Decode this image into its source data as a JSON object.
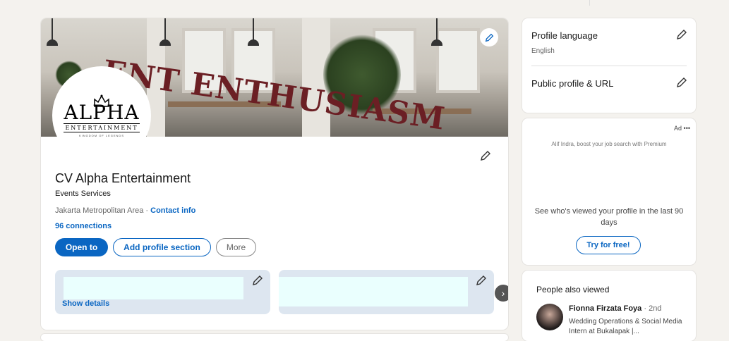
{
  "profile": {
    "banner_text": "ENT ENTHUSIASM",
    "logo": {
      "name": "ALPHA",
      "sub": "ENTERTAINMENT",
      "tiny": "KINGDOM OF LEGENDS"
    },
    "name": "CV Alpha Entertainment",
    "headline": "Events Services",
    "location": "Jakarta Metropolitan Area",
    "separator": " · ",
    "contact_info": "Contact info",
    "connections": "96 connections",
    "buttons": {
      "open_to": "Open to",
      "add_section": "Add profile section",
      "more": "More"
    },
    "show_details": "Show details",
    "next_arrow": "›"
  },
  "settings": {
    "language_title": "Profile language",
    "language_value": "English",
    "url_title": "Public profile & URL"
  },
  "ad": {
    "label": "Ad",
    "menu": "•••",
    "promo": "Alif Indra, boost your job search with Premium",
    "body": "See who's viewed your profile in the last 90 days",
    "cta": "Try for free!"
  },
  "people_also_viewed": {
    "title": "People also viewed",
    "people": [
      {
        "name": "Fionna Firzata Foya",
        "degree": " · 2nd",
        "description": "Wedding Operations & Social Media Intern at Bukalapak |..."
      }
    ]
  },
  "colors": {
    "brand_blue": "#0a66c2",
    "banner_text": "#6b1f24",
    "background": "#f4f2ee"
  },
  "icons": [
    "pencil-icon",
    "chevron-right-icon",
    "crown-icon",
    "ellipsis-icon"
  ]
}
